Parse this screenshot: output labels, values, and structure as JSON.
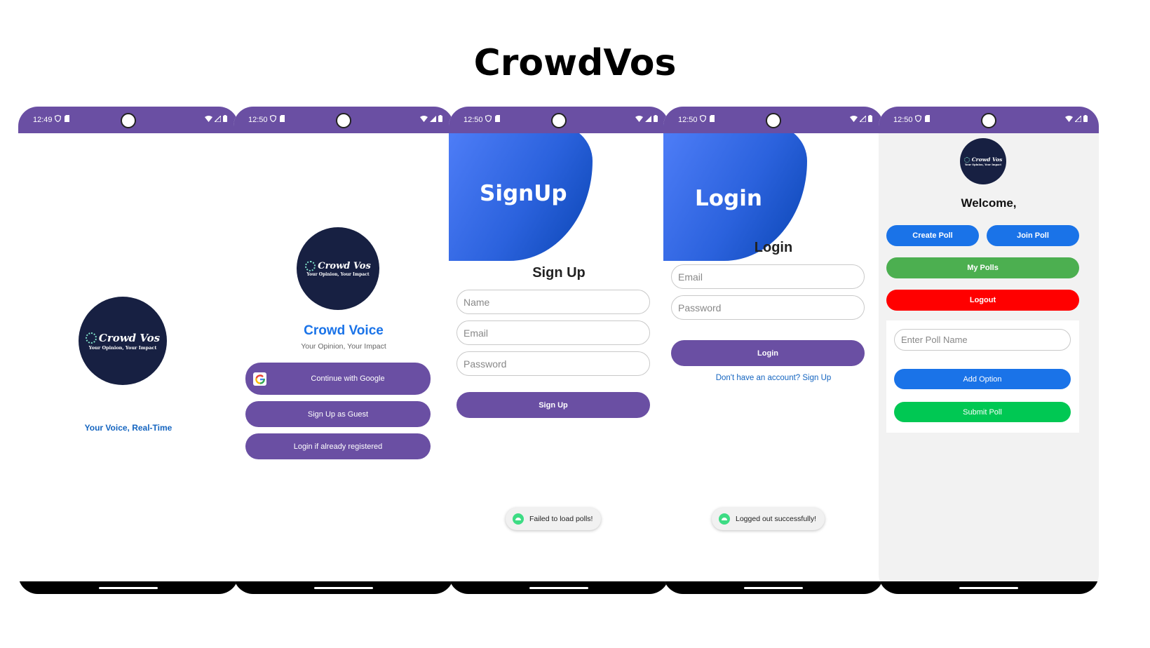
{
  "title": "CrowdVos",
  "logo": {
    "text": "Crowd Vos",
    "tagline": "Your Opinion, Your Impact"
  },
  "status_icons": {
    "left": [
      "shield-icon",
      "sim-icon"
    ],
    "right": [
      "wifi-icon",
      "signal-icon",
      "battery-icon"
    ]
  },
  "screens": {
    "splash": {
      "time": "12:49",
      "tagline": "Your Voice, Real-Time"
    },
    "welcome": {
      "time": "12:50",
      "app_name": "Crowd Voice",
      "subtitle": "Your Opinion, Your Impact",
      "google_button": "Continue with Google",
      "guest_button": "Sign Up as Guest",
      "login_button": "Login if already registered"
    },
    "signup": {
      "time": "12:50",
      "banner": "SignUp",
      "heading": "Sign Up",
      "name_placeholder": "Name",
      "email_placeholder": "Email",
      "password_placeholder": "Password",
      "submit": "Sign Up",
      "toast": "Failed to load polls!"
    },
    "login": {
      "time": "12:50",
      "banner": "Login",
      "heading": "Login",
      "email_placeholder": "Email",
      "password_placeholder": "Password",
      "submit": "Login",
      "signup_link": "Don't have an account? Sign Up",
      "toast": "Logged out successfully!"
    },
    "home": {
      "time": "12:50",
      "welcome": "Welcome,",
      "create_poll": "Create Poll",
      "join_poll": "Join Poll",
      "my_polls": "My Polls",
      "logout": "Logout",
      "poll_name_placeholder": "Enter Poll Name",
      "add_option": "Add Option",
      "submit_poll": "Submit Poll"
    }
  },
  "colors": {
    "status_bar": "#6a4fa3",
    "primary_purple": "#6a4fa3",
    "blue": "#1a73e8",
    "green": "#4caf50",
    "bright_green": "#00c853",
    "red": "#ff0000",
    "logo_bg": "#172042",
    "link_blue": "#1565c0"
  }
}
